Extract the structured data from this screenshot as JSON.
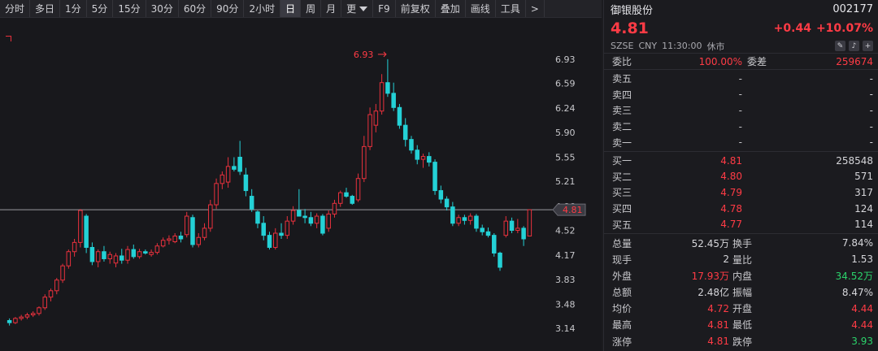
{
  "toolbar": {
    "items": [
      "分时",
      "多日",
      "1分",
      "5分",
      "15分",
      "30分",
      "60分",
      "90分",
      "2小时",
      "日",
      "周",
      "月",
      "更",
      "F9",
      "前复权",
      "叠加",
      "画线",
      "工具",
      ">"
    ],
    "active_index": 9
  },
  "stock": {
    "name": "御银股份",
    "code": "002177",
    "price": "4.81",
    "change": "+0.44",
    "change_pct": "+10.07%",
    "exchange": "SZSE",
    "currency": "CNY",
    "time": "11:30:00",
    "status": "休市",
    "icons": [
      "edit-icon",
      "bell-icon",
      "plus-icon"
    ]
  },
  "weibi": {
    "label": "委比",
    "value": "100.00%",
    "label2": "委差",
    "value2": "259674"
  },
  "asks": [
    {
      "label": "卖五",
      "price": "-",
      "volume": "-"
    },
    {
      "label": "卖四",
      "price": "-",
      "volume": "-"
    },
    {
      "label": "卖三",
      "price": "-",
      "volume": "-"
    },
    {
      "label": "卖二",
      "price": "-",
      "volume": "-"
    },
    {
      "label": "卖一",
      "price": "-",
      "volume": "-"
    }
  ],
  "bids": [
    {
      "label": "买一",
      "price": "4.81",
      "volume": "258548"
    },
    {
      "label": "买二",
      "price": "4.80",
      "volume": "571"
    },
    {
      "label": "买三",
      "price": "4.79",
      "volume": "317"
    },
    {
      "label": "买四",
      "price": "4.78",
      "volume": "124"
    },
    {
      "label": "买五",
      "price": "4.77",
      "volume": "114"
    }
  ],
  "stats": [
    {
      "l1": "总量",
      "v1": "52.45万",
      "c1": "white",
      "l2": "换手",
      "v2": "7.84%",
      "c2": "white"
    },
    {
      "l1": "现手",
      "v1": "2",
      "c1": "white",
      "l2": "量比",
      "v2": "1.53",
      "c2": "white"
    },
    {
      "l1": "外盘",
      "v1": "17.93万",
      "c1": "red",
      "l2": "内盘",
      "v2": "34.52万",
      "c2": "green"
    },
    {
      "l1": "总额",
      "v1": "2.48亿",
      "c1": "white",
      "l2": "振幅",
      "v2": "8.47%",
      "c2": "white"
    },
    {
      "l1": "均价",
      "v1": "4.72",
      "c1": "red",
      "l2": "开盘",
      "v2": "4.44",
      "c2": "red"
    },
    {
      "l1": "最高",
      "v1": "4.81",
      "c1": "red",
      "l2": "最低",
      "v2": "4.44",
      "c2": "red"
    },
    {
      "l1": "涨停",
      "v1": "4.81",
      "c1": "red",
      "l2": "跌停",
      "v2": "3.93",
      "c2": "green"
    }
  ],
  "chart_data": {
    "type": "candlestick",
    "y_ticks": [
      "6.93",
      "6.59",
      "6.24",
      "5.90",
      "5.55",
      "5.21",
      "4.86",
      "4.52",
      "4.17",
      "3.83",
      "3.48",
      "3.14"
    ],
    "ylim": [
      3.05,
      7.02
    ],
    "reference_line": 4.81,
    "current_price_label": "4.81",
    "max_annotation": "6.93",
    "colors": {
      "up": "#e8313d",
      "down": "#24d1d6",
      "ref": "#9a9aa0",
      "bg": "#18181c"
    },
    "candles": [
      [
        3.25,
        3.28,
        3.18,
        3.22
      ],
      [
        3.22,
        3.3,
        3.2,
        3.28
      ],
      [
        3.28,
        3.33,
        3.25,
        3.3
      ],
      [
        3.3,
        3.36,
        3.27,
        3.33
      ],
      [
        3.33,
        3.38,
        3.3,
        3.35
      ],
      [
        3.35,
        3.45,
        3.32,
        3.43
      ],
      [
        3.43,
        3.62,
        3.4,
        3.58
      ],
      [
        3.58,
        3.7,
        3.52,
        3.67
      ],
      [
        3.67,
        3.85,
        3.62,
        3.82
      ],
      [
        3.82,
        4.05,
        3.78,
        4.02
      ],
      [
        4.02,
        4.25,
        3.98,
        4.22
      ],
      [
        4.22,
        4.4,
        4.15,
        4.35
      ],
      [
        4.35,
        4.82,
        4.28,
        4.8
      ],
      [
        4.72,
        4.75,
        4.2,
        4.28
      ],
      [
        4.28,
        4.35,
        4.03,
        4.08
      ],
      [
        4.08,
        4.25,
        4.0,
        4.22
      ],
      [
        4.22,
        4.3,
        4.08,
        4.12
      ],
      [
        4.12,
        4.22,
        4.05,
        4.18
      ],
      [
        4.06,
        4.2,
        4.0,
        4.16
      ],
      [
        4.16,
        4.26,
        4.05,
        4.1
      ],
      [
        4.1,
        4.3,
        4.05,
        4.25
      ],
      [
        4.25,
        4.32,
        4.12,
        4.15
      ],
      [
        4.15,
        4.26,
        4.12,
        4.22
      ],
      [
        4.22,
        4.25,
        4.18,
        4.2
      ],
      [
        4.18,
        4.25,
        4.15,
        4.21
      ],
      [
        4.21,
        4.34,
        4.18,
        4.3
      ],
      [
        4.3,
        4.42,
        4.28,
        4.38
      ],
      [
        4.38,
        4.45,
        4.32,
        4.4
      ],
      [
        4.36,
        4.48,
        4.34,
        4.44
      ],
      [
        4.44,
        4.5,
        4.35,
        4.4
      ],
      [
        4.46,
        4.78,
        4.42,
        4.72
      ],
      [
        4.7,
        4.74,
        4.28,
        4.32
      ],
      [
        4.32,
        4.48,
        4.28,
        4.42
      ],
      [
        4.42,
        4.62,
        4.38,
        4.55
      ],
      [
        4.55,
        4.95,
        4.5,
        4.88
      ],
      [
        4.88,
        5.25,
        4.82,
        5.18
      ],
      [
        5.18,
        5.35,
        5.1,
        5.3
      ],
      [
        5.2,
        5.55,
        5.12,
        5.42
      ],
      [
        5.42,
        5.55,
        5.35,
        5.38
      ],
      [
        5.55,
        5.78,
        5.3,
        5.35
      ],
      [
        5.3,
        5.4,
        5.0,
        5.08
      ],
      [
        5.0,
        5.1,
        4.78,
        4.82
      ],
      [
        4.78,
        4.8,
        4.55,
        4.62
      ],
      [
        4.62,
        4.72,
        4.38,
        4.45
      ],
      [
        4.45,
        4.5,
        4.25,
        4.28
      ],
      [
        4.28,
        4.55,
        4.25,
        4.48
      ],
      [
        4.48,
        4.62,
        4.4,
        4.45
      ],
      [
        4.45,
        4.72,
        4.4,
        4.65
      ],
      [
        4.65,
        4.86,
        4.6,
        4.8
      ],
      [
        4.8,
        5.1,
        4.78,
        4.72
      ],
      [
        4.72,
        4.82,
        4.62,
        4.7
      ],
      [
        4.7,
        4.78,
        4.58,
        4.62
      ],
      [
        4.62,
        4.76,
        4.55,
        4.72
      ],
      [
        4.72,
        4.75,
        4.45,
        4.48
      ],
      [
        4.55,
        4.8,
        4.5,
        4.75
      ],
      [
        4.75,
        4.95,
        4.7,
        4.9
      ],
      [
        4.9,
        5.08,
        4.85,
        5.05
      ],
      [
        5.05,
        5.12,
        4.98,
        5.0
      ],
      [
        5.0,
        5.02,
        4.88,
        4.9
      ],
      [
        4.95,
        5.32,
        4.92,
        5.25
      ],
      [
        5.25,
        5.85,
        5.2,
        5.7
      ],
      [
        5.7,
        6.25,
        5.65,
        6.15
      ],
      [
        6.0,
        6.3,
        5.9,
        6.2
      ],
      [
        6.2,
        6.72,
        6.15,
        6.6
      ],
      [
        6.6,
        6.93,
        6.4,
        6.45
      ],
      [
        6.45,
        6.6,
        6.2,
        6.25
      ],
      [
        6.25,
        6.3,
        5.95,
        6.0
      ],
      [
        6.0,
        6.1,
        5.7,
        5.8
      ],
      [
        5.8,
        5.85,
        5.6,
        5.65
      ],
      [
        5.65,
        5.72,
        5.45,
        5.52
      ],
      [
        5.52,
        5.6,
        5.4,
        5.56
      ],
      [
        5.56,
        5.62,
        5.42,
        5.48
      ],
      [
        5.48,
        5.52,
        5.02,
        5.08
      ],
      [
        5.08,
        5.15,
        4.9,
        4.96
      ],
      [
        4.96,
        5.0,
        4.8,
        4.85
      ],
      [
        4.85,
        4.92,
        4.58,
        4.62
      ],
      [
        4.62,
        4.74,
        4.58,
        4.7
      ],
      [
        4.7,
        4.74,
        4.6,
        4.66
      ],
      [
        4.66,
        4.76,
        4.6,
        4.72
      ],
      [
        4.72,
        4.75,
        4.5,
        4.55
      ],
      [
        4.55,
        4.6,
        4.45,
        4.5
      ],
      [
        4.5,
        4.56,
        4.42,
        4.45
      ],
      [
        4.45,
        4.48,
        4.15,
        4.2
      ],
      [
        4.2,
        4.22,
        3.95,
        4.0
      ],
      [
        4.45,
        4.72,
        4.42,
        4.65
      ],
      [
        4.65,
        4.7,
        4.48,
        4.52
      ],
      [
        4.52,
        4.68,
        4.48,
        4.55
      ],
      [
        4.55,
        4.58,
        4.3,
        4.4
      ],
      [
        4.44,
        4.81,
        4.44,
        4.81
      ]
    ]
  }
}
